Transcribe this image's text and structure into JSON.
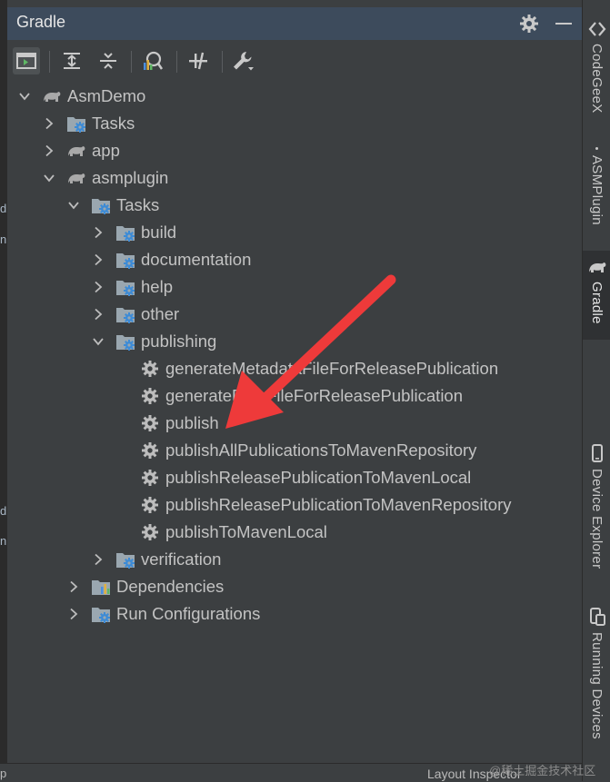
{
  "panel": {
    "title": "Gradle"
  },
  "toolbar": {
    "buttons": [
      "execute-task-icon",
      "expand-all-icon",
      "collapse-all-icon",
      "analyze-icon",
      "toggle-offline-icon",
      "settings-wrench-icon"
    ]
  },
  "tree": [
    {
      "label": "AsmDemo",
      "depth": 0,
      "chevron": "down",
      "icon": "elephant"
    },
    {
      "label": "Tasks",
      "depth": 1,
      "chevron": "right",
      "icon": "folder-gear"
    },
    {
      "label": "app",
      "depth": 1,
      "chevron": "right",
      "icon": "elephant"
    },
    {
      "label": "asmplugin",
      "depth": 1,
      "chevron": "down",
      "icon": "elephant"
    },
    {
      "label": "Tasks",
      "depth": 2,
      "chevron": "down",
      "icon": "folder-gear"
    },
    {
      "label": "build",
      "depth": 3,
      "chevron": "right",
      "icon": "folder-gear"
    },
    {
      "label": "documentation",
      "depth": 3,
      "chevron": "right",
      "icon": "folder-gear"
    },
    {
      "label": "help",
      "depth": 3,
      "chevron": "right",
      "icon": "folder-gear"
    },
    {
      "label": "other",
      "depth": 3,
      "chevron": "right",
      "icon": "folder-gear"
    },
    {
      "label": "publishing",
      "depth": 3,
      "chevron": "down",
      "icon": "folder-gear"
    },
    {
      "label": "generateMetadataFileForReleasePublication",
      "depth": 4,
      "chevron": "none",
      "icon": "gear"
    },
    {
      "label": "generatePomFileForReleasePublication",
      "depth": 4,
      "chevron": "none",
      "icon": "gear"
    },
    {
      "label": "publish",
      "depth": 4,
      "chevron": "none",
      "icon": "gear"
    },
    {
      "label": "publishAllPublicationsToMavenRepository",
      "depth": 4,
      "chevron": "none",
      "icon": "gear"
    },
    {
      "label": "publishReleasePublicationToMavenLocal",
      "depth": 4,
      "chevron": "none",
      "icon": "gear"
    },
    {
      "label": "publishReleasePublicationToMavenRepository",
      "depth": 4,
      "chevron": "none",
      "icon": "gear"
    },
    {
      "label": "publishToMavenLocal",
      "depth": 4,
      "chevron": "none",
      "icon": "gear"
    },
    {
      "label": "verification",
      "depth": 3,
      "chevron": "right",
      "icon": "folder-gear"
    },
    {
      "label": "Dependencies",
      "depth": 2,
      "chevron": "right",
      "icon": "folder-chart"
    },
    {
      "label": "Run Configurations",
      "depth": 2,
      "chevron": "right",
      "icon": "folder-gear"
    }
  ],
  "right_tabs": [
    {
      "label": "CodeGeeX",
      "icon": "codegeex-icon"
    },
    {
      "label": "ASMPlugin",
      "icon": "dot-icon"
    },
    {
      "label": "Gradle",
      "icon": "elephant-icon",
      "selected": true
    },
    {
      "label": "Device Explorer",
      "icon": "device-icon"
    },
    {
      "label": "Running Devices",
      "icon": "running-devices-icon"
    }
  ],
  "left_gutter": [
    "d",
    "n",
    "d",
    "n"
  ],
  "bottom": {
    "left": "p",
    "right": "Layout Inspector"
  },
  "watermark": "@稀土掘金技术社区",
  "colors": {
    "arrow": "#ee3a3a",
    "header": "#3d4b5c",
    "panel": "#3c3f41"
  }
}
